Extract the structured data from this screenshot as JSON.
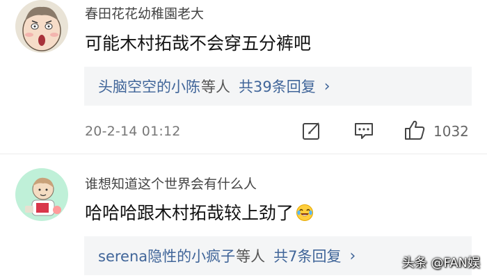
{
  "comments": [
    {
      "username": "春田花花幼稚園老大",
      "content": "可能木村拓哉不会穿五分裤吧",
      "reply": {
        "names": "头脑空空的小陈",
        "etc": "等人",
        "count": "共39条回复",
        "chevron": "›"
      },
      "time": "20-2-14 01:12",
      "likes": "1032",
      "avatar_icon": "cartoon-face-avatar"
    },
    {
      "username": "谁想知道这个世界会有什么人",
      "content": "哈哈哈跟木村拓哉较上劲了",
      "emoji": "laughing-tears-emoji",
      "reply": {
        "names": "serena隐性的小疯子",
        "etc": "等人",
        "count": "共7条回复",
        "chevron": "›"
      },
      "avatar_icon": "cartoon-kid-avatar"
    }
  ],
  "icons": {
    "edit": "edit-icon",
    "comment": "comment-icon",
    "like": "thumbs-up-icon"
  },
  "watermark": "头条 @FAN娱",
  "colors": {
    "link": "#406599",
    "reply_bg": "#f4f5f6"
  }
}
